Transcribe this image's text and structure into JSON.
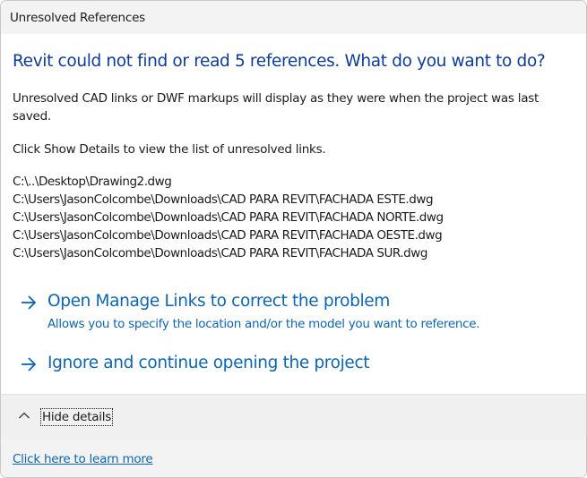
{
  "dialog": {
    "title": "Unresolved References",
    "main_instruction": "Revit could not find or read 5 references. What do you want to do?",
    "content": "Unresolved CAD links or DWF markups will display as they were when the project was last saved.",
    "details_prompt": "Click Show Details to view the list of unresolved links.",
    "references": [
      "C:\\..\\Desktop\\Drawing2.dwg",
      "C:\\Users\\JasonColcombe\\Downloads\\CAD PARA REVIT\\FACHADA ESTE.dwg",
      "C:\\Users\\JasonColcombe\\Downloads\\CAD PARA REVIT\\FACHADA NORTE.dwg",
      "C:\\Users\\JasonColcombe\\Downloads\\CAD PARA REVIT\\FACHADA OESTE.dwg",
      "C:\\Users\\JasonColcombe\\Downloads\\CAD PARA REVIT\\FACHADA SUR.dwg"
    ],
    "commands": [
      {
        "label": "Open Manage Links to correct the problem",
        "description": "Allows you to specify the location and/or the model you want to reference.",
        "icon": "arrow-right-icon"
      },
      {
        "label": "Ignore and continue opening the project",
        "icon": "arrow-right-icon"
      }
    ],
    "expander": {
      "label": "Hide details",
      "icon": "chevron-up-icon"
    },
    "footer_link": "Click here to learn more"
  },
  "colors": {
    "instruction": "#0a3c9c",
    "link": "#0a66b8",
    "text": "#1b1b1b",
    "chrome": "#f3f3f3",
    "content_bg": "#ffffff"
  }
}
